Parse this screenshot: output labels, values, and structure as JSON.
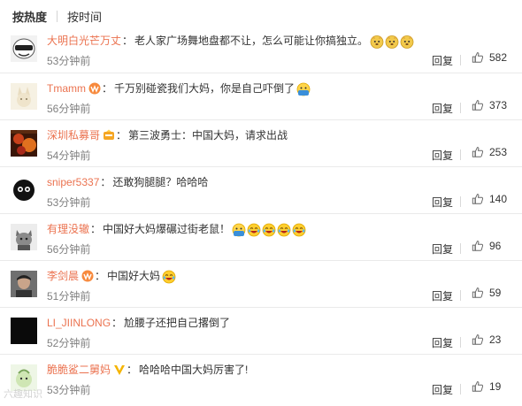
{
  "sort": {
    "hot": "按热度",
    "time": "按时间"
  },
  "ui": {
    "reply": "回复"
  },
  "comments": [
    {
      "user": "大明白光芒万丈",
      "badge": "",
      "text": "老人家广场舞地盘都不让，怎么可能让你搞独立。",
      "emojis": [
        "dog-face-emoji",
        "dog-face-emoji",
        "dog-face-emoji"
      ],
      "time": "53分钟前",
      "likes": "582",
      "avatar": "black-white-mask-avatar"
    },
    {
      "user": "Tmamm",
      "badge": "vip-badge",
      "text": "千万别碰瓷我们大妈，你是自己吓倒了",
      "emojis": [
        "doge-shock-emoji"
      ],
      "time": "56分钟前",
      "likes": "373",
      "avatar": "cream-cartoon-avatar"
    },
    {
      "user": "深圳私募哥",
      "badge": "fan-badge",
      "text": "第三波勇士：中国大妈，请求出战",
      "emojis": [],
      "time": "54分钟前",
      "likes": "253",
      "avatar": "red-orange-photo-avatar"
    },
    {
      "user": "sniper5337",
      "badge": "",
      "text": "还敢狗腿腿？哈哈哈",
      "emojis": [],
      "time": "53分钟前",
      "likes": "140",
      "avatar": "black-furball-avatar"
    },
    {
      "user": "有理没辙",
      "badge": "",
      "text": "中国好大妈爆碾过街老鼠！",
      "emojis": [
        "doge-shock-emoji",
        "laugh-tears-emoji",
        "laugh-tears-emoji",
        "laugh-tears-emoji",
        "laugh-tears-emoji"
      ],
      "time": "56分钟前",
      "likes": "96",
      "avatar": "gray-cat-avatar"
    },
    {
      "user": "李剑晨",
      "badge": "vip-badge",
      "text": "中国好大妈",
      "emojis": [
        "laugh-tears-emoji"
      ],
      "time": "51分钟前",
      "likes": "59",
      "avatar": "portrait-photo-avatar"
    },
    {
      "user": "LI_JIINLONG",
      "badge": "",
      "text": "尬腰子还把自己撂倒了",
      "emojis": [],
      "time": "52分钟前",
      "likes": "23",
      "avatar": "black-square-avatar"
    },
    {
      "user": "脆脆鲨二舅妈",
      "badge": "verified-v-badge",
      "text": "哈哈哈中国大妈厉害了!",
      "emojis": [],
      "time": "53分钟前",
      "likes": "19",
      "avatar": "green-cartoon-avatar"
    }
  ],
  "watermark": "六趣知识"
}
